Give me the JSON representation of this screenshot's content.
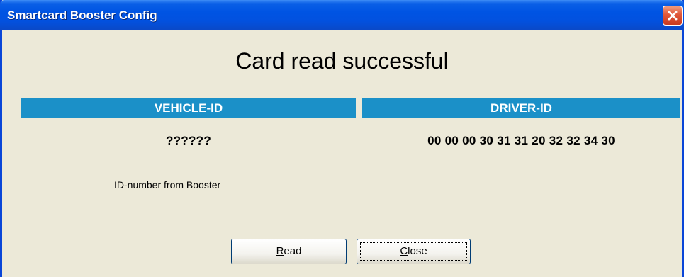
{
  "window": {
    "title": "Smartcard Booster Config"
  },
  "status": {
    "headline": "Card read successful"
  },
  "vehicle": {
    "header": "VEHICLE-ID",
    "value": "??????",
    "note": "ID-number from Booster"
  },
  "driver": {
    "header": "DRIVER-ID",
    "value": "00 00 00 30 31 31 20 32 32 34 30"
  },
  "buttons": {
    "read_accel": "R",
    "read_rest": "ead",
    "close_accel": "C",
    "close_rest": "lose"
  },
  "colors": {
    "titlebar": "#0054e3",
    "window_border": "#0a46d8",
    "dialog_bg": "#ece9d8",
    "header_bg": "#1b90c8",
    "close_button": "#e0573a"
  },
  "icons": {
    "close": "close-icon"
  }
}
